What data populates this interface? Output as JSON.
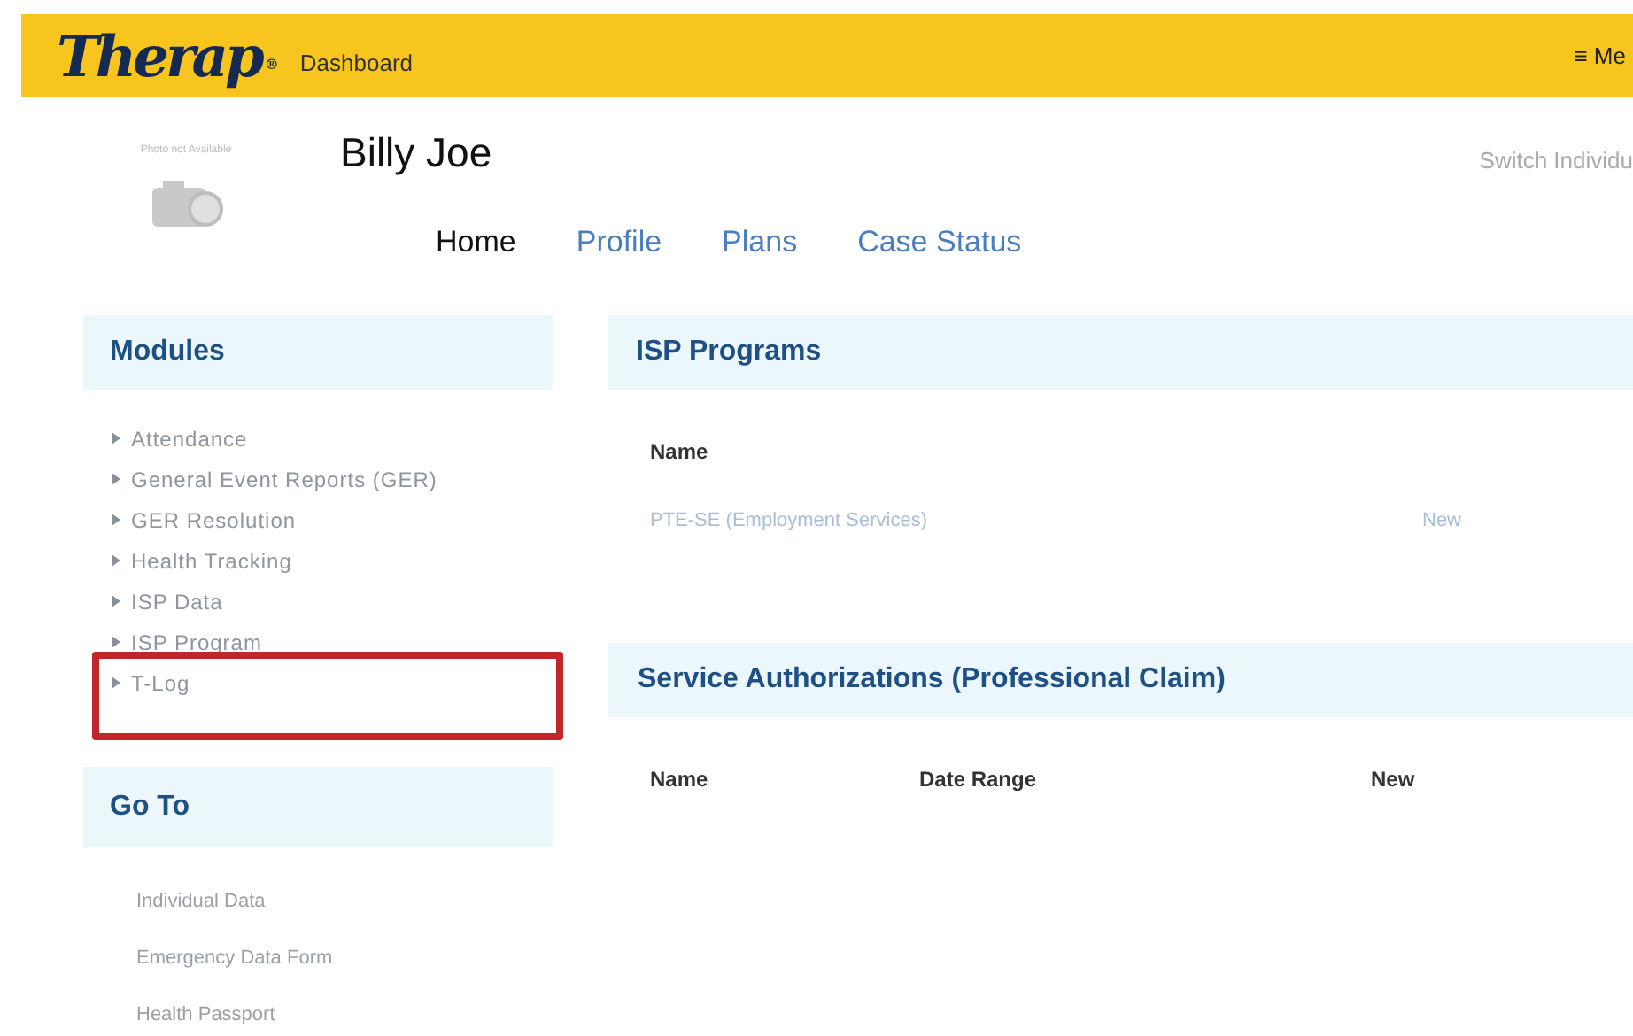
{
  "header": {
    "logo": "Therap",
    "logo_mark": "®",
    "title": "Dashboard",
    "menu": "≡ Me"
  },
  "profile": {
    "photo_caption": "Photo not Available",
    "name": "Billy Joe",
    "switch": "Switch Individu",
    "tabs": [
      {
        "label": "Home",
        "selected": true
      },
      {
        "label": "Profile",
        "selected": false
      },
      {
        "label": "Plans",
        "selected": false
      },
      {
        "label": "Case Status",
        "selected": false
      }
    ]
  },
  "modules": {
    "title": "Modules",
    "items": [
      {
        "label": "Attendance",
        "highlighted": false
      },
      {
        "label": "General Event Reports (GER)",
        "highlighted": false
      },
      {
        "label": "GER Resolution",
        "highlighted": false
      },
      {
        "label": "Health Tracking",
        "highlighted": false
      },
      {
        "label": "ISP Data",
        "highlighted": false
      },
      {
        "label": "ISP Program",
        "highlighted": false
      },
      {
        "label": "T-Log",
        "highlighted": true
      }
    ]
  },
  "goto": {
    "title": "Go To",
    "items": [
      "Individual Data",
      "Emergency Data Form",
      "Health Passport"
    ]
  },
  "isp_programs": {
    "title": "ISP Programs",
    "columns": [
      "Name"
    ],
    "rows": [
      {
        "name": "PTE-SE (Employment Services)",
        "action": "New"
      }
    ]
  },
  "service_authorizations": {
    "title": "Service Authorizations (Professional Claim)",
    "columns": [
      "Name",
      "Date Range",
      "New"
    ]
  }
}
